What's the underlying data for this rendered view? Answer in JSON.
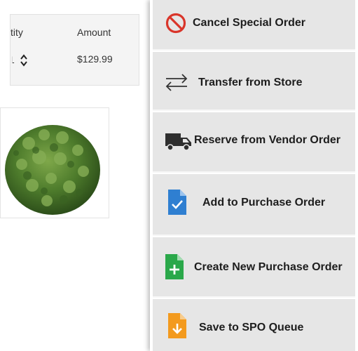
{
  "order": {
    "quantity_header": "tity",
    "amount_header": "Amount",
    "quantity_value": "1",
    "amount_value": "$129.99"
  },
  "product": {
    "icon": "shrub-image"
  },
  "menu": {
    "items": [
      {
        "label": "Cancel Special Order",
        "icon": "cancel-icon",
        "color": "#d9352a"
      },
      {
        "label": "Transfer from Store",
        "icon": "transfer-arrows-icon",
        "color": "#333333"
      },
      {
        "label": "Reserve from Vendor Order",
        "icon": "truck-icon",
        "color": "#2e2e2e"
      },
      {
        "label": "Add to Purchase Order",
        "icon": "document-check-icon",
        "color": "#2f7fd1"
      },
      {
        "label": "Create New Purchase Order",
        "icon": "document-plus-icon",
        "color": "#2aa84a"
      },
      {
        "label": "Save to SPO Queue",
        "icon": "document-download-icon",
        "color": "#f39a1e"
      }
    ]
  }
}
